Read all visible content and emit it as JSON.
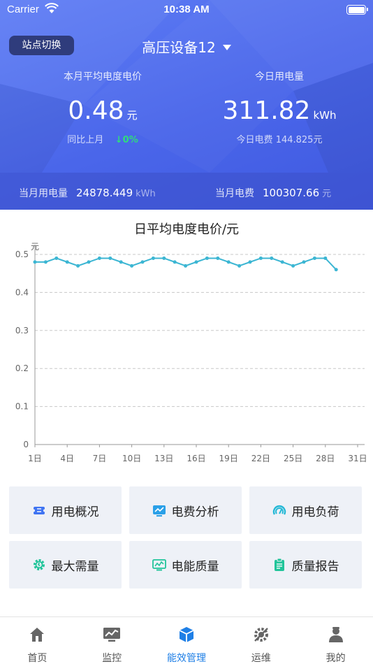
{
  "status_bar": {
    "carrier": "Carrier",
    "time": "10:38 AM"
  },
  "header": {
    "switch_label": "站点切换",
    "device_title": "高压设备12",
    "avg_price": {
      "label": "本月平均电度电价",
      "value": "0.48",
      "unit": "元",
      "compare_label": "同比上月",
      "compare_value": "↓0%"
    },
    "today_usage": {
      "label": "今日用电量",
      "value": "311.82",
      "unit": "kWh",
      "fee_label": "今日电费",
      "fee_value": "144.825元"
    },
    "month_usage": {
      "label": "当月用电量",
      "value": "24878.449",
      "unit": "kWh"
    },
    "month_fee": {
      "label": "当月电费",
      "value": "100307.66",
      "unit": "元"
    }
  },
  "chart_data": {
    "type": "line",
    "title": "日平均电度电价/元",
    "ylabel": "元",
    "ylim": [
      0,
      0.5
    ],
    "yticks": [
      "0",
      "0.1",
      "0.2",
      "0.3",
      "0.4",
      "0.5"
    ],
    "xlim": [
      1,
      31
    ],
    "xticks": [
      "1日",
      "4日",
      "7日",
      "10日",
      "13日",
      "16日",
      "19日",
      "22日",
      "25日",
      "28日",
      "31日"
    ],
    "grid": true,
    "series": [
      {
        "x": [
          1,
          2,
          3,
          4,
          5,
          6,
          7,
          8,
          9,
          10,
          11,
          12,
          13,
          14,
          15,
          16,
          17,
          18,
          19,
          20,
          21,
          22,
          23,
          24,
          25,
          26,
          27,
          28,
          29
        ],
        "values": [
          0.48,
          0.48,
          0.49,
          0.48,
          0.47,
          0.48,
          0.49,
          0.49,
          0.48,
          0.47,
          0.48,
          0.49,
          0.49,
          0.48,
          0.47,
          0.48,
          0.49,
          0.49,
          0.48,
          0.47,
          0.48,
          0.49,
          0.49,
          0.48,
          0.47,
          0.48,
          0.49,
          0.49,
          0.46
        ]
      }
    ],
    "line_color": "#3cb6d3"
  },
  "grid_buttons": [
    {
      "label": "用电概况",
      "icon": "ticket-icon",
      "color": "#3f74f2"
    },
    {
      "label": "电费分析",
      "icon": "chart-icon",
      "color": "#2aa0e8"
    },
    {
      "label": "用电负荷",
      "icon": "gauge-icon",
      "color": "#26b9d6"
    },
    {
      "label": "最大需量",
      "icon": "gear-icon",
      "color": "#21c49a"
    },
    {
      "label": "电能质量",
      "icon": "monitor-icon",
      "color": "#21c49a"
    },
    {
      "label": "质量报告",
      "icon": "clipboard-icon",
      "color": "#21c49a"
    }
  ],
  "tabs": [
    {
      "label": "首页",
      "icon": "home-icon"
    },
    {
      "label": "监控",
      "icon": "monitor-chart-icon"
    },
    {
      "label": "能效管理",
      "icon": "cube-icon",
      "active": true
    },
    {
      "label": "运维",
      "icon": "tools-icon"
    },
    {
      "label": "我的",
      "icon": "user-icon"
    }
  ],
  "colors": {
    "accent": "#1f7fe6",
    "header_blue": "#4a66ea",
    "up_down_green": "#2fdc7c"
  }
}
